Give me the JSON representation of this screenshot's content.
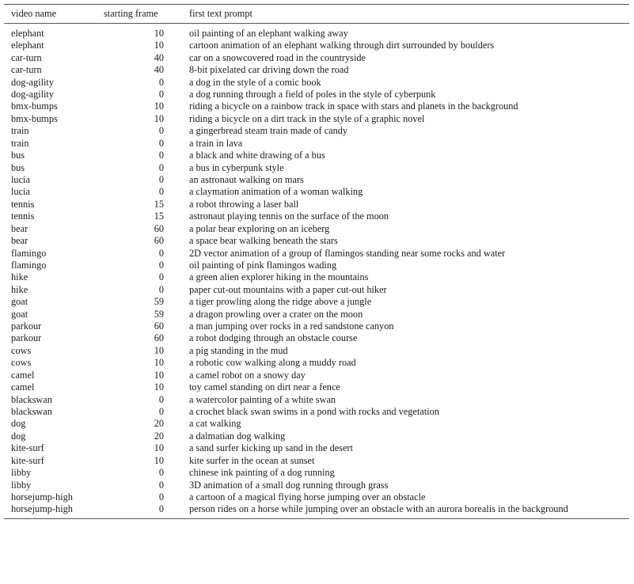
{
  "table": {
    "columns": [
      {
        "key": "video_name",
        "label": "video name"
      },
      {
        "key": "starting_frame",
        "label": "starting frame"
      },
      {
        "key": "first_text_prompt",
        "label": "first text prompt"
      }
    ],
    "rows": [
      {
        "video_name": "elephant",
        "starting_frame": "10",
        "first_text_prompt": "oil painting of an elephant walking away"
      },
      {
        "video_name": "elephant",
        "starting_frame": "10",
        "first_text_prompt": "cartoon animation of an elephant walking through dirt surrounded by boulders"
      },
      {
        "video_name": "car-turn",
        "starting_frame": "40",
        "first_text_prompt": "car on a snowcovered road in the countryside"
      },
      {
        "video_name": "car-turn",
        "starting_frame": "40",
        "first_text_prompt": "8-bit pixelated car driving down the road"
      },
      {
        "video_name": "dog-agility",
        "starting_frame": "0",
        "first_text_prompt": "a dog in the style of a comic book"
      },
      {
        "video_name": "dog-agility",
        "starting_frame": "0",
        "first_text_prompt": "a dog running through a field of poles in the style of cyberpunk"
      },
      {
        "video_name": "bmx-bumps",
        "starting_frame": "10",
        "first_text_prompt": "riding a bicycle on a rainbow track in space with stars and planets in the background"
      },
      {
        "video_name": "bmx-bumps",
        "starting_frame": "10",
        "first_text_prompt": "riding a bicycle on a dirt track in the style of a graphic novel"
      },
      {
        "video_name": "train",
        "starting_frame": "0",
        "first_text_prompt": "a gingerbread steam train made of candy"
      },
      {
        "video_name": "train",
        "starting_frame": "0",
        "first_text_prompt": "a train in lava"
      },
      {
        "video_name": "bus",
        "starting_frame": "0",
        "first_text_prompt": "a black and white drawing of a bus"
      },
      {
        "video_name": "bus",
        "starting_frame": "0",
        "first_text_prompt": "a bus in cyberpunk style"
      },
      {
        "video_name": "lucia",
        "starting_frame": "0",
        "first_text_prompt": "an astronaut walking on mars"
      },
      {
        "video_name": "lucia",
        "starting_frame": "0",
        "first_text_prompt": "a claymation animation of a woman walking"
      },
      {
        "video_name": "tennis",
        "starting_frame": "15",
        "first_text_prompt": "a robot throwing a laser ball"
      },
      {
        "video_name": "tennis",
        "starting_frame": "15",
        "first_text_prompt": "astronaut playing tennis on the surface of the moon"
      },
      {
        "video_name": "bear",
        "starting_frame": "60",
        "first_text_prompt": "a polar bear exploring on an iceberg"
      },
      {
        "video_name": "bear",
        "starting_frame": "60",
        "first_text_prompt": "a space bear walking beneath the stars"
      },
      {
        "video_name": "flamingo",
        "starting_frame": "0",
        "first_text_prompt": "2D vector animation of a group of flamingos standing near some rocks and water"
      },
      {
        "video_name": "flamingo",
        "starting_frame": "0",
        "first_text_prompt": "oil painting of pink flamingos wading"
      },
      {
        "video_name": "hike",
        "starting_frame": "0",
        "first_text_prompt": "a green alien explorer hiking in the mountains"
      },
      {
        "video_name": "hike",
        "starting_frame": "0",
        "first_text_prompt": "paper cut-out mountains with a paper cut-out hiker"
      },
      {
        "video_name": "goat",
        "starting_frame": "59",
        "first_text_prompt": "a tiger prowling along the ridge above a jungle"
      },
      {
        "video_name": "goat",
        "starting_frame": "59",
        "first_text_prompt": "a dragon prowling over a crater on the moon"
      },
      {
        "video_name": "parkour",
        "starting_frame": "60",
        "first_text_prompt": "a man jumping over rocks in a red sandstone canyon"
      },
      {
        "video_name": "parkour",
        "starting_frame": "60",
        "first_text_prompt": "a robot dodging through an obstacle course"
      },
      {
        "video_name": "cows",
        "starting_frame": "10",
        "first_text_prompt": "a pig standing in the mud"
      },
      {
        "video_name": "cows",
        "starting_frame": "10",
        "first_text_prompt": "a robotic cow walking along a muddy road"
      },
      {
        "video_name": "camel",
        "starting_frame": "10",
        "first_text_prompt": "a camel robot on a snowy day"
      },
      {
        "video_name": "camel",
        "starting_frame": "10",
        "first_text_prompt": "toy camel standing on dirt near a fence"
      },
      {
        "video_name": "blackswan",
        "starting_frame": "0",
        "first_text_prompt": "a watercolor painting of a white swan"
      },
      {
        "video_name": "blackswan",
        "starting_frame": "0",
        "first_text_prompt": "a crochet black swan swims in a pond with rocks and vegetation"
      },
      {
        "video_name": "dog",
        "starting_frame": "20",
        "first_text_prompt": "a cat walking"
      },
      {
        "video_name": "dog",
        "starting_frame": "20",
        "first_text_prompt": "a dalmatian dog walking"
      },
      {
        "video_name": "kite-surf",
        "starting_frame": "10",
        "first_text_prompt": "a sand surfer kicking up sand in the desert"
      },
      {
        "video_name": "kite-surf",
        "starting_frame": "10",
        "first_text_prompt": "kite surfer in the ocean at sunset"
      },
      {
        "video_name": "libby",
        "starting_frame": "0",
        "first_text_prompt": "chinese ink painting of a dog running"
      },
      {
        "video_name": "libby",
        "starting_frame": "0",
        "first_text_prompt": "3D animation of a small dog running through grass"
      },
      {
        "video_name": "horsejump-high",
        "starting_frame": "0",
        "first_text_prompt": "a cartoon of a magical flying horse jumping over an obstacle"
      },
      {
        "video_name": "horsejump-high",
        "starting_frame": "0",
        "first_text_prompt": "person rides on a horse while jumping over an obstacle with an aurora borealis in the background"
      }
    ]
  },
  "style": {
    "rule_color": "#55565a",
    "text_color": "#1b1b1b",
    "background": "#ffffff"
  }
}
